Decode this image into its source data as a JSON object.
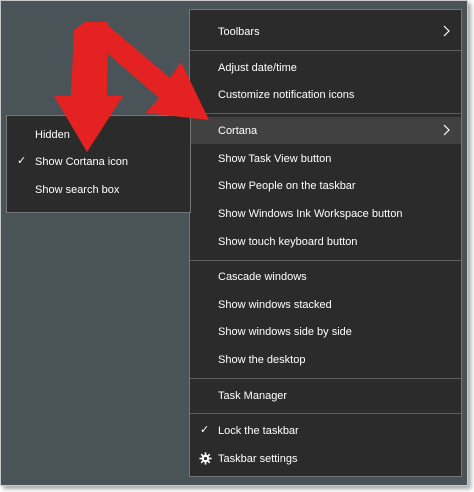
{
  "main_menu": {
    "toolbars": "Toolbars",
    "adjust_datetime": "Adjust date/time",
    "customize_icons": "Customize notification icons",
    "cortana": "Cortana",
    "show_task_view": "Show Task View button",
    "show_people": "Show People on the taskbar",
    "show_ink": "Show Windows Ink Workspace button",
    "show_touch_keyboard": "Show touch keyboard button",
    "cascade": "Cascade windows",
    "stacked": "Show windows stacked",
    "side_by_side": "Show windows side by side",
    "show_desktop": "Show the desktop",
    "task_manager": "Task Manager",
    "lock_taskbar": "Lock the taskbar",
    "taskbar_settings": "Taskbar settings",
    "lock_checked": true
  },
  "cortana_submenu": {
    "hidden": "Hidden",
    "show_icon": "Show Cortana icon",
    "show_search_box": "Show search box",
    "selected": "Show Cortana icon"
  },
  "icons": {
    "check": "check-mark-icon",
    "chevron": "chevron-right-icon",
    "gear": "gear-icon"
  },
  "colors": {
    "desktop_background": "#4a5357",
    "menu_background": "#2b2b2b",
    "menu_hover": "#414141",
    "arrow": "#e52222"
  }
}
